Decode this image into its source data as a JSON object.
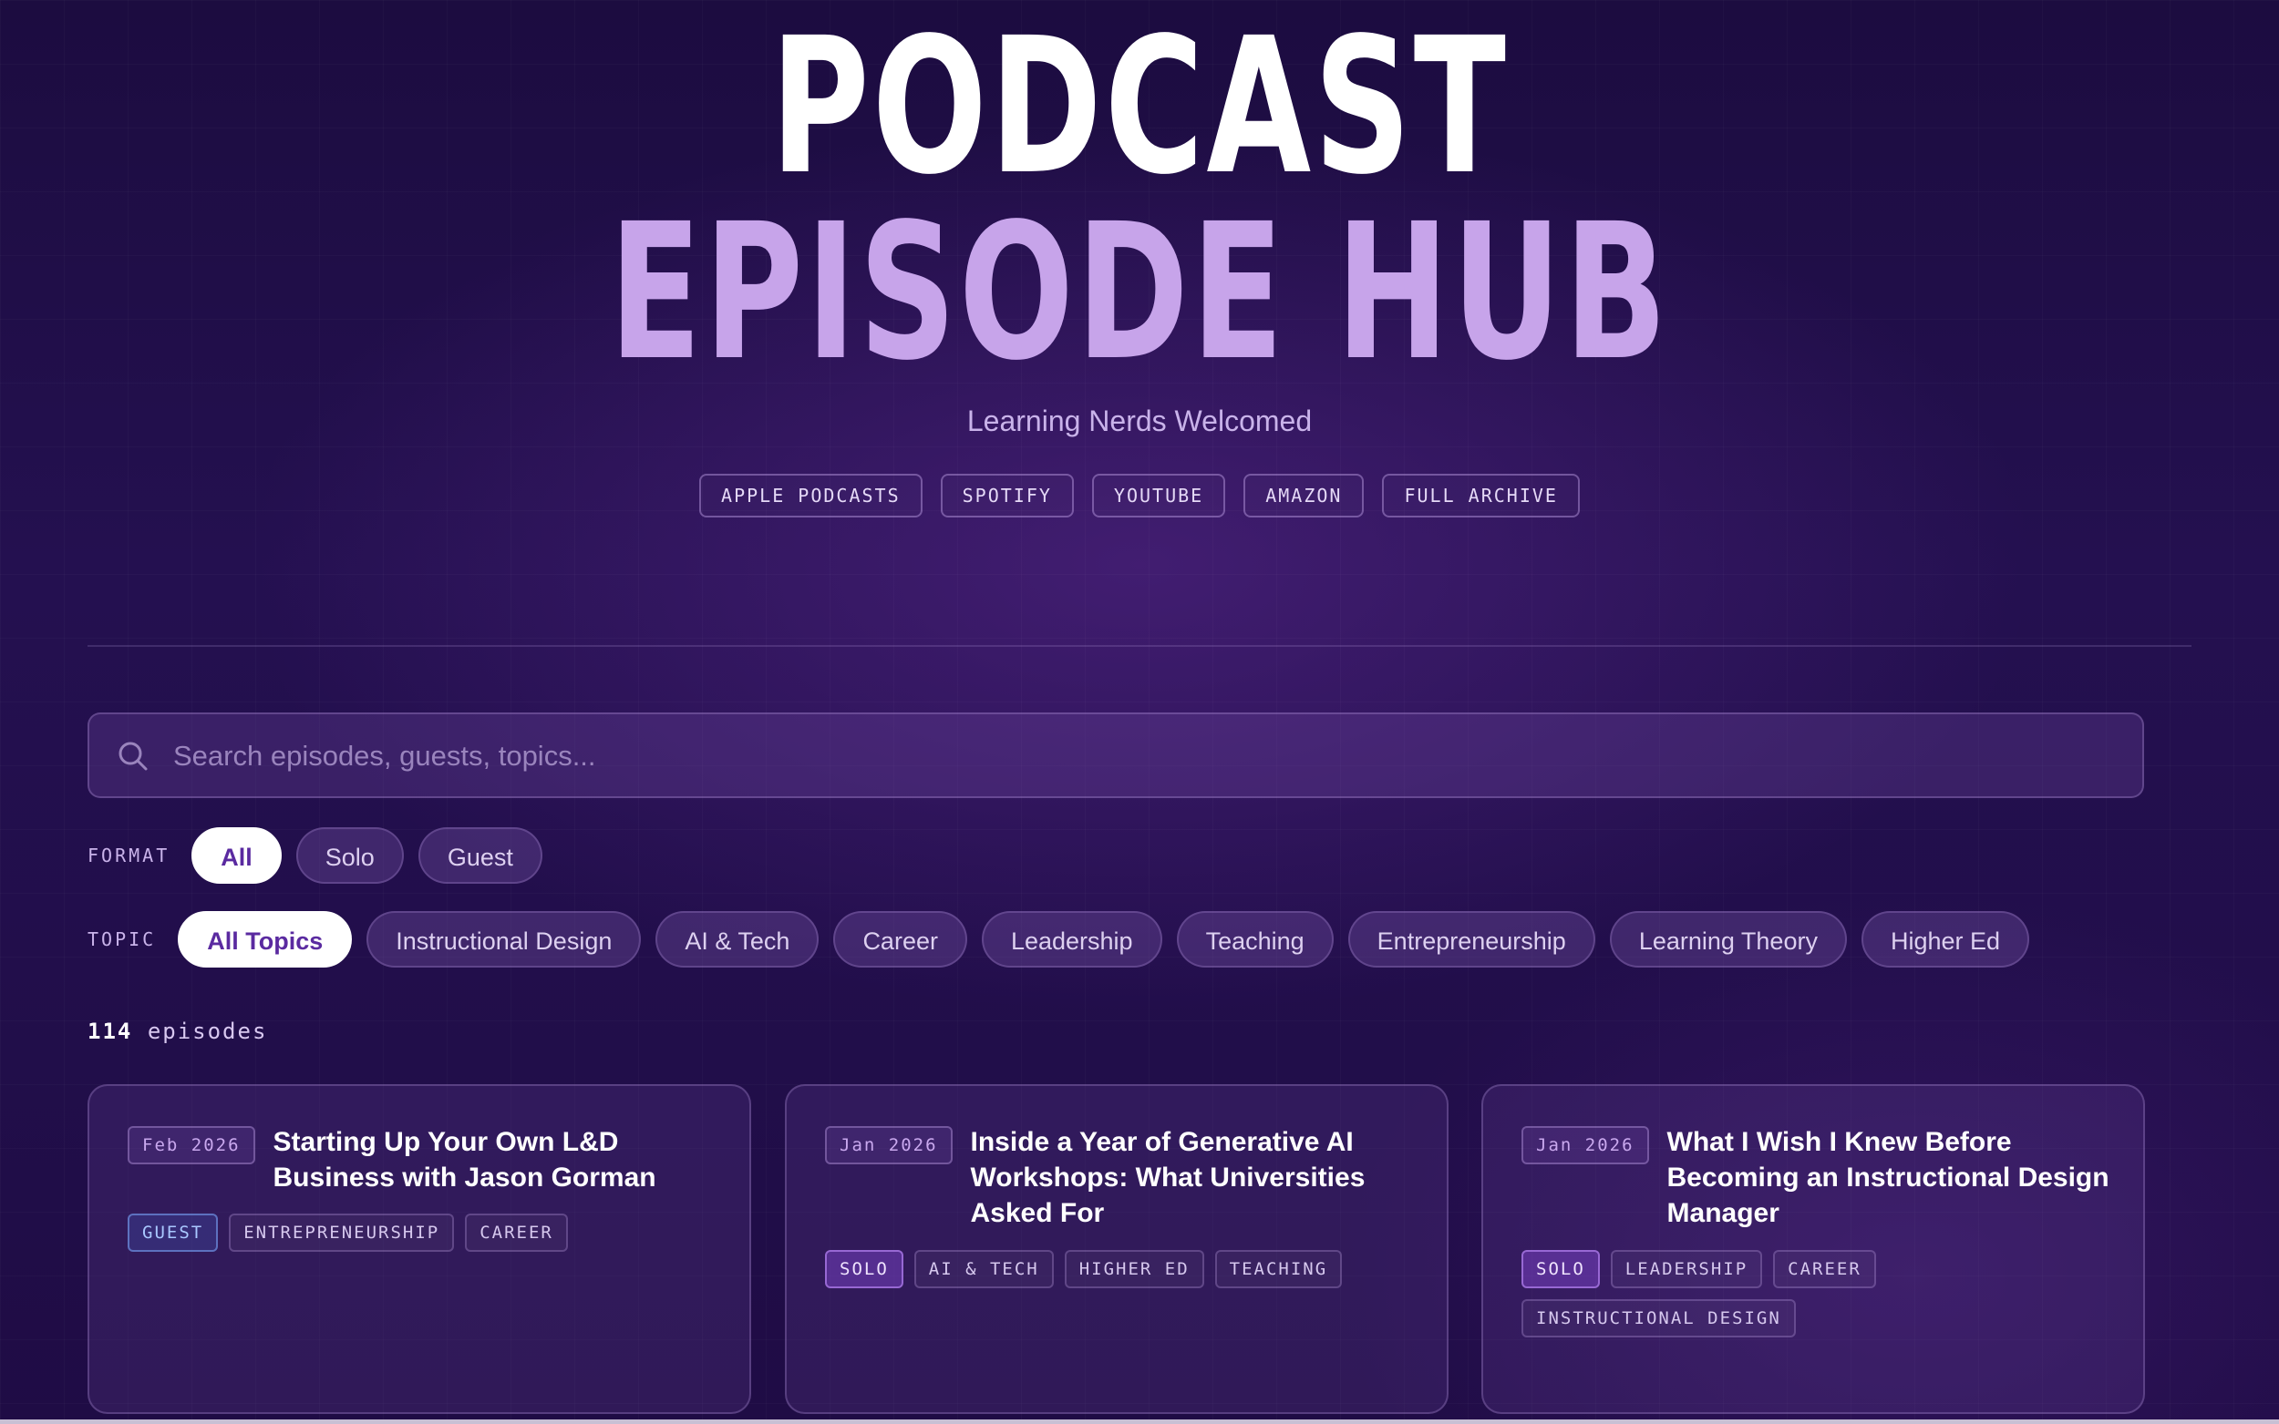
{
  "header": {
    "title_line1": "PODCAST",
    "title_line2": "EPISODE HUB",
    "subtitle": "Learning Nerds Welcomed",
    "links": [
      "APPLE PODCASTS",
      "SPOTIFY",
      "YOUTUBE",
      "AMAZON",
      "FULL ARCHIVE"
    ]
  },
  "search": {
    "placeholder": "Search episodes, guests, topics...",
    "icon": "search-icon"
  },
  "filters": {
    "format": {
      "label": "FORMAT",
      "options": [
        "All",
        "Solo",
        "Guest"
      ],
      "selected": "All"
    },
    "topic": {
      "label": "TOPIC",
      "options": [
        "All Topics",
        "Instructional Design",
        "AI & Tech",
        "Career",
        "Leadership",
        "Teaching",
        "Entrepreneurship",
        "Learning Theory",
        "Higher Ed"
      ],
      "selected": "All Topics"
    }
  },
  "results": {
    "count": "114",
    "count_label": "episodes"
  },
  "episodes": [
    {
      "date": "Feb 2026",
      "title": "Starting Up Your Own L&D Business with Jason Gorman",
      "tags": [
        "GUEST",
        "ENTREPRENEURSHIP",
        "CAREER"
      ]
    },
    {
      "date": "Jan 2026",
      "title": "Inside a Year of Generative AI Workshops: What Universities Asked For",
      "tags": [
        "SOLO",
        "AI & TECH",
        "HIGHER ED",
        "TEACHING"
      ]
    },
    {
      "date": "Jan 2026",
      "title": "What I Wish I Knew Before Becoming an Instructional Design Manager",
      "tags": [
        "SOLO",
        "LEADERSHIP",
        "CAREER",
        "INSTRUCTIONAL DESIGN"
      ]
    }
  ],
  "colors": {
    "accent": "#c7a4ea",
    "background": "#1f0c45",
    "guest_tag": "#a9c8ff",
    "solo_tag": "#8246d2"
  }
}
